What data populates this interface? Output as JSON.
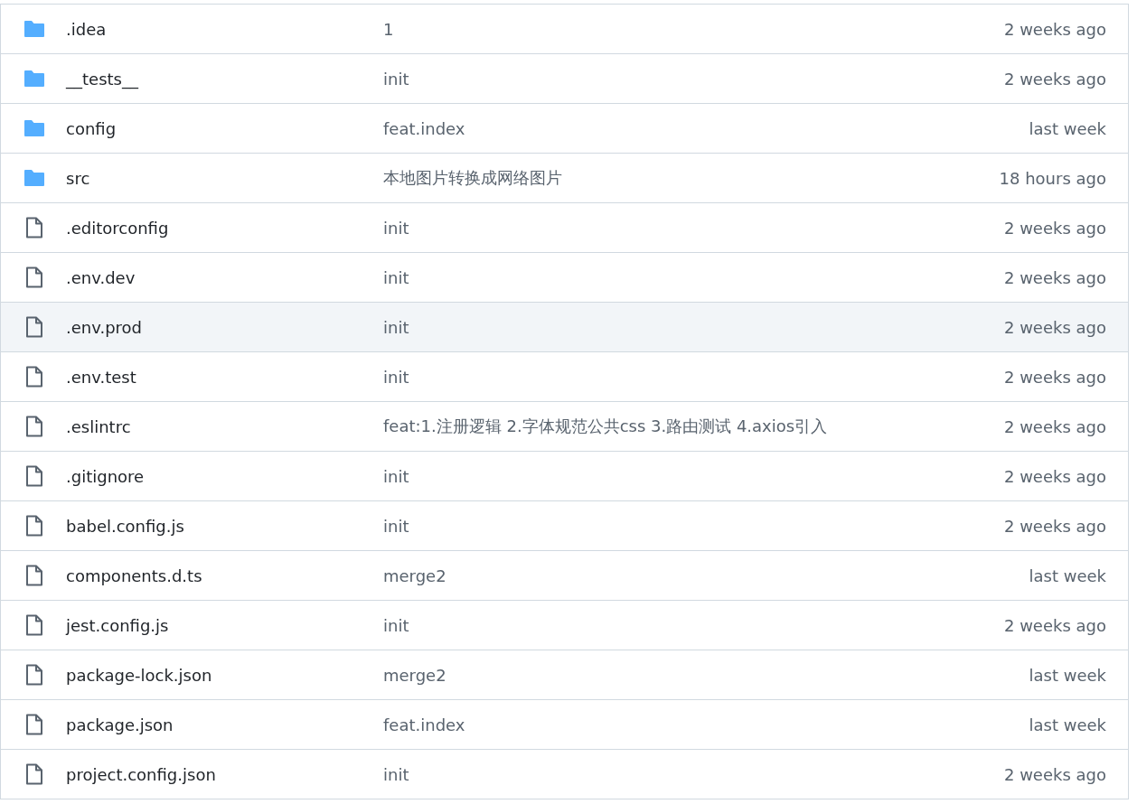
{
  "files": [
    {
      "kind": "folder",
      "name": ".idea",
      "message": "1",
      "date": "2 weeks ago",
      "selected": false
    },
    {
      "kind": "folder",
      "name": "__tests__",
      "message": "init",
      "date": "2 weeks ago",
      "selected": false
    },
    {
      "kind": "folder",
      "name": "config",
      "message": "feat.index",
      "date": "last week",
      "selected": false
    },
    {
      "kind": "folder",
      "name": "src",
      "message": "本地图片转换成网络图片",
      "date": "18 hours ago",
      "selected": false
    },
    {
      "kind": "file",
      "name": ".editorconfig",
      "message": "init",
      "date": "2 weeks ago",
      "selected": false
    },
    {
      "kind": "file",
      "name": ".env.dev",
      "message": "init",
      "date": "2 weeks ago",
      "selected": false
    },
    {
      "kind": "file",
      "name": ".env.prod",
      "message": "init",
      "date": "2 weeks ago",
      "selected": true
    },
    {
      "kind": "file",
      "name": ".env.test",
      "message": "init",
      "date": "2 weeks ago",
      "selected": false
    },
    {
      "kind": "file",
      "name": ".eslintrc",
      "message": "feat:1.注册逻辑 2.字体规范公共css 3.路由测试 4.axios引入",
      "date": "2 weeks ago",
      "selected": false
    },
    {
      "kind": "file",
      "name": ".gitignore",
      "message": "init",
      "date": "2 weeks ago",
      "selected": false
    },
    {
      "kind": "file",
      "name": "babel.config.js",
      "message": "init",
      "date": "2 weeks ago",
      "selected": false
    },
    {
      "kind": "file",
      "name": "components.d.ts",
      "message": "merge2",
      "date": "last week",
      "selected": false
    },
    {
      "kind": "file",
      "name": "jest.config.js",
      "message": "init",
      "date": "2 weeks ago",
      "selected": false
    },
    {
      "kind": "file",
      "name": "package-lock.json",
      "message": "merge2",
      "date": "last week",
      "selected": false
    },
    {
      "kind": "file",
      "name": "package.json",
      "message": "feat.index",
      "date": "last week",
      "selected": false
    },
    {
      "kind": "file",
      "name": "project.config.json",
      "message": "init",
      "date": "2 weeks ago",
      "selected": false
    }
  ]
}
